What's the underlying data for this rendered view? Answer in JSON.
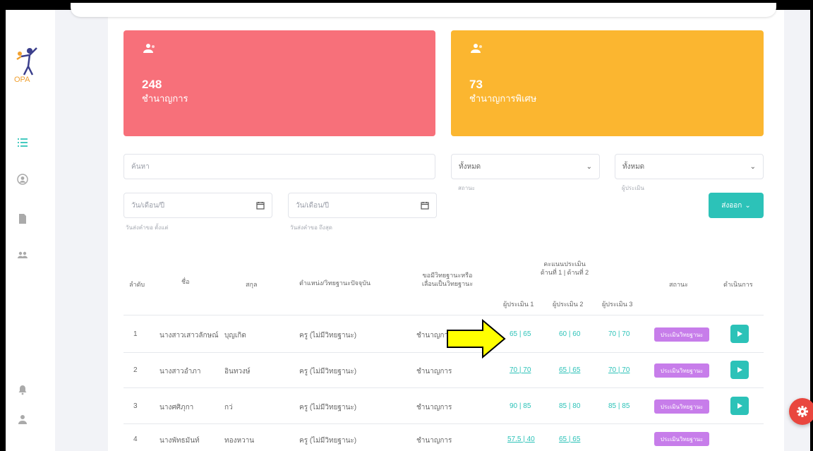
{
  "app": {
    "logo_text": "OPA"
  },
  "cards": [
    {
      "count": "248",
      "label": "ชำนาญการ",
      "color": "#f7707a"
    },
    {
      "count": "73",
      "label": "ชำนาญการพิเศษ",
      "color": "#fbb630"
    }
  ],
  "filters": {
    "search_placeholder": "ค้นหา",
    "status_select": "ทั้งหมด",
    "status_label": "สถานะ",
    "subject_select": "ทั้งหมด",
    "subject_label": "ผู้ประเมิน",
    "date_from": "วัน/เดือน/ปี",
    "date_from_label": "วันส่งคำขอ ตั้งแต่",
    "date_to": "วัน/เดือน/ปี",
    "date_to_label": "วันส่งคำขอ ถึงสุด",
    "export_label": "ส่งออก"
  },
  "table": {
    "headers": {
      "order": "ลำดับ",
      "name": "ชื่อ",
      "surname": "สกุล",
      "position": "ตำแหน่ง/วิทยฐานะปัจจุบัน",
      "request_line1": "ขอมีวิทยฐานะหรือ",
      "request_line2": "เลื่อนเป็นวิทยฐานะ",
      "score_line1": "คะแนนประเมิน",
      "score_line2": "ด้านที่ 1 | ด้านที่ 2",
      "evaluator1": "ผู้ประเมิน 1",
      "evaluator2": "ผู้ประเมิน 2",
      "evaluator3": "ผู้ประเมิน 3",
      "status": "สถานะ",
      "action": "ดำเนินการ"
    },
    "rows": [
      {
        "order": "1",
        "name": "นางสาวเสาวลักษณ์",
        "surname": "บุญเกิด",
        "position": "ครู (ไม่มีวิทยฐานะ)",
        "request": "ชำนาญการ",
        "s1": "65 | 65",
        "s2": "60 | 60",
        "s3": "70 | 70",
        "status": "ประเมินวิทยฐานะ"
      },
      {
        "order": "2",
        "name": "นางสาวอำภา",
        "surname": "อินทวงษ์",
        "position": "ครู (ไม่มีวิทยฐานะ)",
        "request": "ชำนาญการ",
        "s1": "70 | 70",
        "s2": "65 | 65",
        "s3": "70 | 70",
        "status": "ประเมินวิทยฐานะ"
      },
      {
        "order": "3",
        "name": "นางศศิภุกา",
        "surname": "กว่",
        "position": "ครู (ไม่มีวิทยฐานะ)",
        "request": "ชำนาญการ",
        "s1": "90 | 85",
        "s2": "85 | 80",
        "s3": "85 | 85",
        "status": "ประเมินวิทยฐานะ"
      },
      {
        "order": "4",
        "name": "นางพัทธมันท์",
        "surname": "ทองหวาน",
        "position": "ครู (ไม่มีวิทยฐานะ)",
        "request": "ชำนาญการ",
        "s1": "57.5 | 40",
        "s2": "65 | 65",
        "s3": "",
        "status": "ประเมินวิทยฐานะ"
      }
    ]
  },
  "colors": {
    "teal": "#2cc2b8",
    "purple": "#c77dea",
    "red": "#f7707a",
    "yellow": "#fbb630"
  }
}
